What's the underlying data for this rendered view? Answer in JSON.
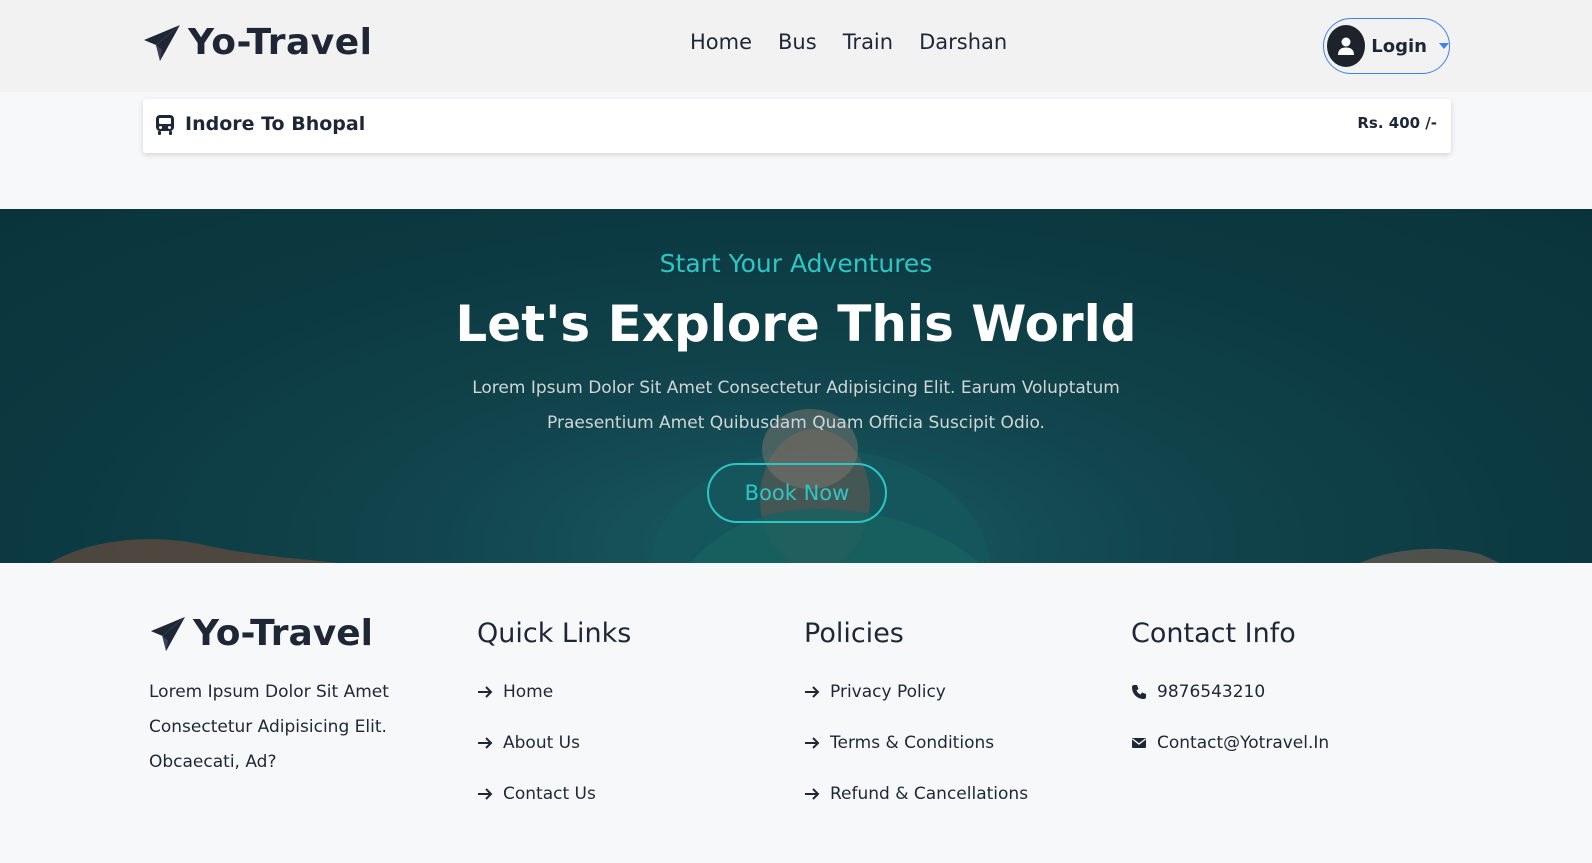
{
  "header": {
    "brand": "Yo-Travel",
    "nav": [
      "Home",
      "Bus",
      "Train",
      "Darshan"
    ],
    "login_label": "Login"
  },
  "route_card": {
    "route": "Indore To Bhopal",
    "price": "Rs. 400 /-"
  },
  "hero": {
    "subtitle": "Start Your Adventures",
    "title": "Let's Explore This World",
    "description": "Lorem Ipsum Dolor Sit Amet Consectetur Adipisicing Elit. Earum Voluptatum Praesentium Amet Quibusdam Quam Officia Suscipit Odio.",
    "button": "Book Now"
  },
  "footer": {
    "brand": "Yo-Travel",
    "about": "Lorem Ipsum Dolor Sit Amet Consectetur Adipisicing Elit. Obcaecati, Ad?",
    "quick_links": {
      "title": "Quick Links",
      "items": [
        "Home",
        "About Us",
        "Contact Us"
      ]
    },
    "policies": {
      "title": "Policies",
      "items": [
        "Privacy Policy",
        "Terms & Conditions",
        "Refund & Cancellations"
      ]
    },
    "contact": {
      "title": "Contact Info",
      "phone": "9876543210",
      "email": "Contact@Yotravel.In"
    }
  },
  "colors": {
    "accent": "#2ec6c4",
    "dark": "#1f2737",
    "hero_bg": "#0c3a42",
    "login_border": "#3b82f6"
  }
}
